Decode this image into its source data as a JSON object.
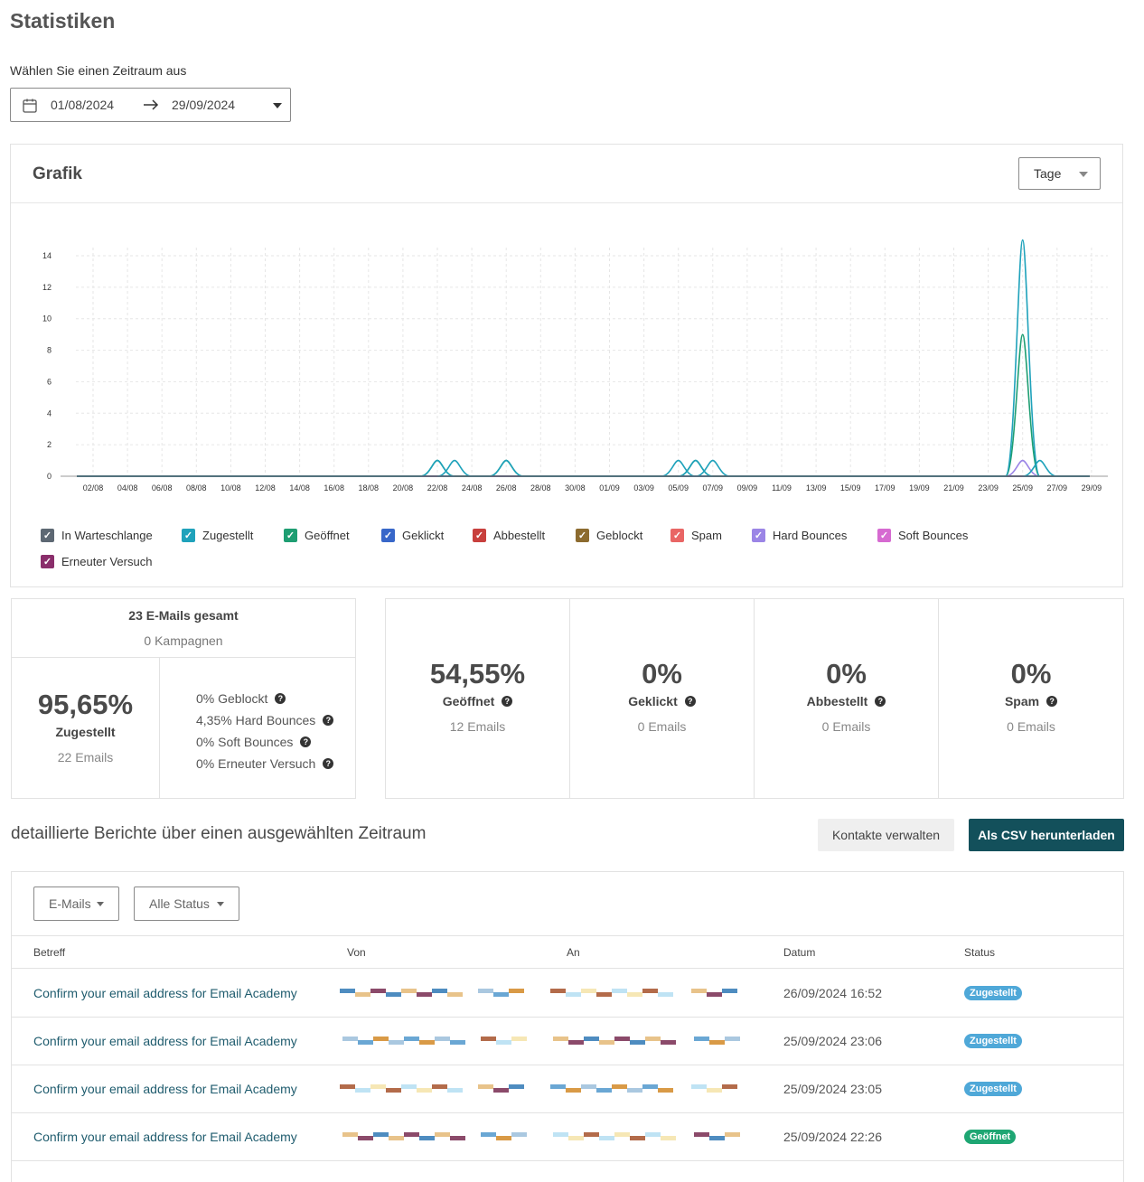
{
  "page": {
    "title": "Statistiken",
    "period_label": "Wählen Sie einen Zeitraum aus"
  },
  "date_range": {
    "start": "01/08/2024",
    "end": "29/09/2024"
  },
  "graph": {
    "title": "Grafik",
    "granularity": "Tage"
  },
  "chart_data": {
    "type": "line",
    "x": [
      "02/08",
      "04/08",
      "06/08",
      "08/08",
      "10/08",
      "12/08",
      "14/08",
      "16/08",
      "18/08",
      "20/08",
      "22/08",
      "24/08",
      "26/08",
      "28/08",
      "30/08",
      "01/09",
      "03/09",
      "05/09",
      "07/09",
      "09/09",
      "11/09",
      "13/09",
      "15/09",
      "17/09",
      "19/09",
      "21/09",
      "23/09",
      "25/09",
      "27/09",
      "29/09"
    ],
    "yticks": [
      0,
      2,
      4,
      6,
      8,
      10,
      12,
      14
    ],
    "ylim": [
      0,
      15
    ],
    "grid": true,
    "legend_position": "bottom",
    "series": [
      {
        "name": "In Warteschlange",
        "color": "#5d6873",
        "points": []
      },
      {
        "name": "Zugestellt",
        "color": "#1fa2bb",
        "points": [
          [
            "22/08",
            1
          ],
          [
            "23/08",
            1
          ],
          [
            "26/08",
            1
          ],
          [
            "05/09",
            1
          ],
          [
            "06/09",
            1
          ],
          [
            "07/09",
            1
          ],
          [
            "25/09",
            15
          ],
          [
            "26/09",
            1
          ]
        ]
      },
      {
        "name": "Geöffnet",
        "color": "#1e9e72",
        "points": [
          [
            "22/08",
            1
          ],
          [
            "26/08",
            1
          ],
          [
            "06/09",
            1
          ],
          [
            "25/09",
            9
          ]
        ]
      },
      {
        "name": "Geklickt",
        "color": "#3867c9",
        "points": []
      },
      {
        "name": "Abbestellt",
        "color": "#c8403d",
        "points": []
      },
      {
        "name": "Geblockt",
        "color": "#8c6b2f",
        "points": []
      },
      {
        "name": "Spam",
        "color": "#e96665",
        "points": []
      },
      {
        "name": "Hard Bounces",
        "color": "#9b85e6",
        "points": [
          [
            "25/09",
            1
          ]
        ]
      },
      {
        "name": "Soft Bounces",
        "color": "#d66ad1",
        "points": []
      },
      {
        "name": "Erneuter Versuch",
        "color": "#8a2e6b",
        "points": []
      }
    ]
  },
  "summary": {
    "total": "23 E-Mails gesamt",
    "campaigns": "0 Kampagnen",
    "delivered_pct": "95,65%",
    "delivered_label": "Zugestellt",
    "delivered_count": "22 Emails",
    "details": [
      "0% Geblockt",
      "4,35% Hard Bounces",
      "0% Soft Bounces",
      "0% Erneuter Versuch"
    ]
  },
  "stats": [
    {
      "pct": "54,55%",
      "label": "Geöffnet",
      "count": "12 Emails"
    },
    {
      "pct": "0%",
      "label": "Geklickt",
      "count": "0 Emails"
    },
    {
      "pct": "0%",
      "label": "Abbestellt",
      "count": "0 Emails"
    },
    {
      "pct": "0%",
      "label": "Spam",
      "count": "0 Emails"
    }
  ],
  "reports": {
    "title": "detaillierte Berichte über einen ausgewählten Zeitraum",
    "manage_contacts": "Kontakte verwalten",
    "download_csv": "Als CSV herunterladen",
    "filter_type": "E-Mails",
    "filter_status": "Alle Status",
    "columns": [
      "Betreff",
      "Von",
      "An",
      "Datum",
      "Status"
    ],
    "rows": [
      {
        "subject": "Confirm your email address for Email Academy",
        "date": "26/09/2024 16:52",
        "status": "Zugestellt",
        "status_color": "#4fa8d8"
      },
      {
        "subject": "Confirm your email address for Email Academy",
        "date": "25/09/2024 23:06",
        "status": "Zugestellt",
        "status_color": "#4fa8d8"
      },
      {
        "subject": "Confirm your email address for Email Academy",
        "date": "25/09/2024 23:05",
        "status": "Zugestellt",
        "status_color": "#4fa8d8"
      },
      {
        "subject": "Confirm your email address for Email Academy",
        "date": "25/09/2024 22:26",
        "status": "Geöffnet",
        "status_color": "#1ea673"
      }
    ]
  }
}
